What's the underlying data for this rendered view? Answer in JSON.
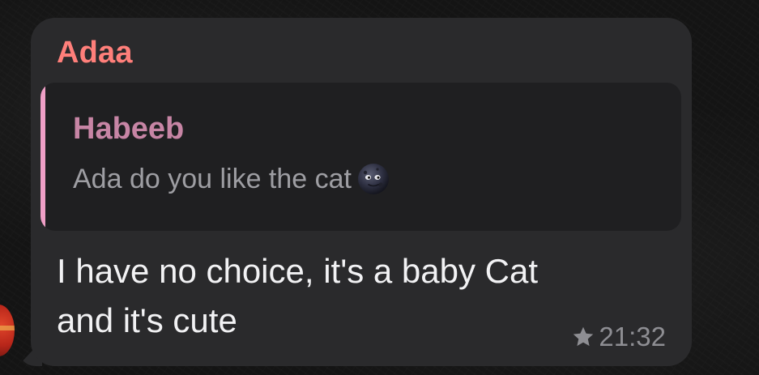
{
  "message": {
    "sender": "Adaa",
    "reply": {
      "author": "Habeeb",
      "text": "Ada do you like the cat",
      "emoji_icon": "new-moon-face-emoji"
    },
    "body_lines": [
      "I have no choice, it's a baby Cat",
      "and it's cute"
    ],
    "time": "21:32",
    "status_icon": "star-icon"
  },
  "colors": {
    "bubble": "#2a2a2c",
    "sender_name": "#ff7f7a",
    "reply_author": "#c785a5",
    "reply_bar": "#ef9fc6",
    "body_text": "#f2f2f4",
    "meta_text": "#8e8e93"
  }
}
